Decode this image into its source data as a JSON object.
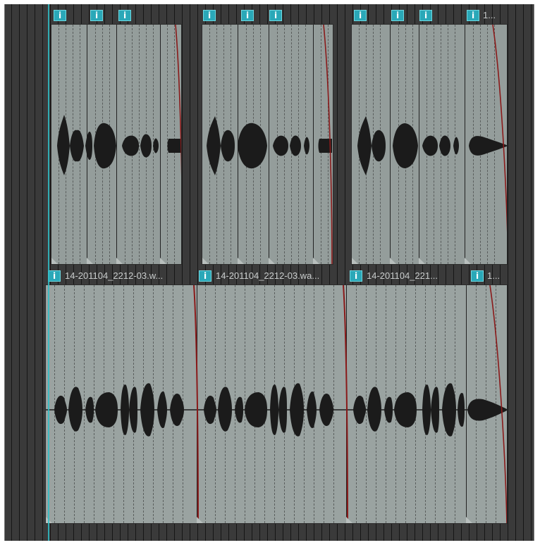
{
  "timeline": {
    "top_row": {
      "clips": [
        {
          "id": "top-clip-1",
          "markers": [
            "i",
            "i",
            "i"
          ]
        },
        {
          "id": "top-clip-2",
          "markers": [
            "i",
            "i",
            "i"
          ]
        },
        {
          "id": "top-clip-3",
          "markers": [
            "i",
            "i",
            "i",
            "i"
          ],
          "label": "1..."
        }
      ]
    },
    "bottom_row": {
      "clips": [
        {
          "id": "bottom-clip-1",
          "marker": "i",
          "label": "14-201104_2212-03.w..."
        },
        {
          "id": "bottom-clip-2",
          "marker": "i",
          "label": "14-201104_2212-03.wa..."
        },
        {
          "id": "bottom-clip-3",
          "marker": "i",
          "label": "14-201104_221..."
        },
        {
          "id": "bottom-clip-4",
          "marker": "i",
          "label": "1..."
        }
      ]
    }
  },
  "colors": {
    "background": "#3a3a3a",
    "clip_fill": "#949d9b",
    "waveform": "#1b1b1b",
    "fade_curve": "#8a1a1a",
    "marker": "#2aa8b8",
    "cursor": "#2fc0c8"
  }
}
